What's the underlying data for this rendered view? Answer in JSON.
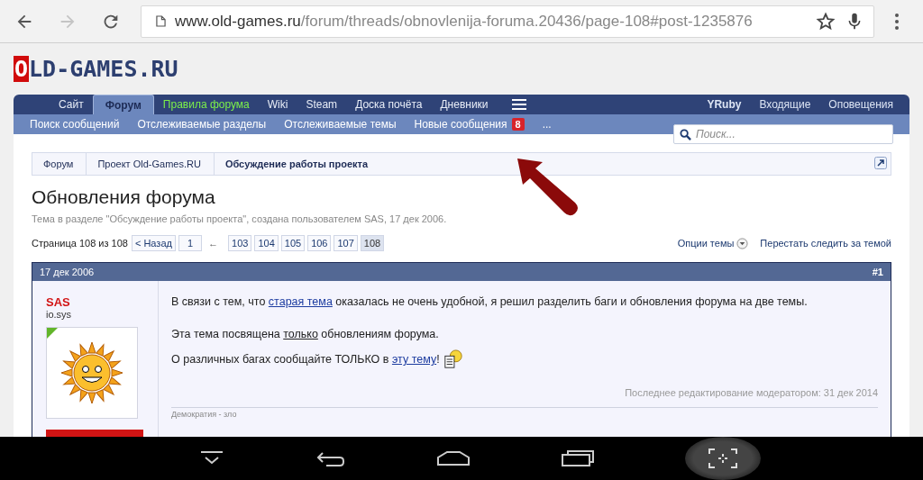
{
  "browser": {
    "url": {
      "domain": "www.old-games.ru",
      "path": "/forum/threads/obnovlenija-foruma.20436/page-108#post-1235876"
    },
    "forward_disabled": true
  },
  "logo": {
    "first": "O",
    "rest": "LD-GAMES.RU"
  },
  "nav": {
    "tabs": [
      {
        "label": "Сайт",
        "selected": false,
        "kind": "normal"
      },
      {
        "label": "Форум",
        "selected": true,
        "kind": "normal"
      },
      {
        "label": "Правила форума",
        "selected": false,
        "kind": "highlight"
      },
      {
        "label": "Wiki",
        "selected": false,
        "kind": "normal"
      },
      {
        "label": "Steam",
        "selected": false,
        "kind": "normal"
      },
      {
        "label": "Доска почёта",
        "selected": false,
        "kind": "normal"
      },
      {
        "label": "Дневники",
        "selected": false,
        "kind": "normal"
      }
    ],
    "user": "YRuby",
    "links": [
      "Входящие",
      "Оповещения"
    ]
  },
  "subnav": {
    "items": [
      {
        "label": "Поиск сообщений"
      },
      {
        "label": "Отслеживаемые разделы"
      },
      {
        "label": "Отслеживаемые темы"
      },
      {
        "label": "Новые сообщения",
        "badge": "8"
      },
      {
        "label": "..."
      }
    ],
    "search": {
      "placeholder": "Поиск..."
    }
  },
  "breadcrumbs": [
    {
      "label": "Форум",
      "current": false
    },
    {
      "label": "Проект Old-Games.RU",
      "current": false
    },
    {
      "label": "Обсуждение работы проекта",
      "current": true
    }
  ],
  "thread": {
    "title": "Обновления форума",
    "meta": "Тема в разделе \"Обсуждение работы проекта\", создана пользователем SAS, 17 дек 2006."
  },
  "pagination": {
    "label": "Страница 108 из 108",
    "prev": "< Назад",
    "first": "1",
    "gap": "←",
    "pages": [
      {
        "label": "103",
        "selected": false
      },
      {
        "label": "104",
        "selected": false
      },
      {
        "label": "105",
        "selected": false
      },
      {
        "label": "106",
        "selected": false
      },
      {
        "label": "107",
        "selected": false
      },
      {
        "label": "108",
        "selected": true
      }
    ]
  },
  "thread_tools": [
    "Опции темы",
    "Перестать следить за темой"
  ],
  "post": {
    "date": "17 дек 2006",
    "number": "#1",
    "author": "SAS",
    "user_title": "io.sys",
    "paragraphs": [
      [
        {
          "kind": "text",
          "text": "В связи с тем, что "
        },
        {
          "kind": "link",
          "text": "старая тема"
        },
        {
          "kind": "text",
          "text": " оказалась не очень удобной, я решил разделить баги и обновления форума на две темы."
        }
      ],
      [
        {
          "kind": "text",
          "text": "Эта тема посвящена "
        },
        {
          "kind": "underline",
          "text": "только"
        },
        {
          "kind": "text",
          "text": " обновлениям форума."
        }
      ],
      [
        {
          "kind": "text",
          "text": "О различных багах сообщайте ТОЛЬКО в "
        },
        {
          "kind": "link",
          "text": "эту тему"
        },
        {
          "kind": "text",
          "text": "!"
        },
        {
          "kind": "smiley"
        }
      ]
    ],
    "edit_note": "Последнее редактирование модератором: 31 дек 2014",
    "signature": "Демократия - зло"
  }
}
